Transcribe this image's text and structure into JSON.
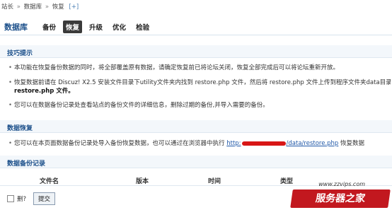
{
  "breadcrumb": {
    "items": [
      "站长",
      "数据库",
      "恢复"
    ],
    "separator": "»",
    "plus": "[+]"
  },
  "header": {
    "title": "数据库",
    "tabs": [
      "备份",
      "恢复",
      "升级",
      "优化",
      "检验"
    ],
    "active_tab": "恢复"
  },
  "tips": {
    "heading": "技巧提示",
    "items": [
      "本功能在恢复备份数据的同时，将全部覆盖原有数据，请确定恢复前已将论坛关闭，恢复全部完成后可以将论坛重新开放。",
      "恢复数据前请在 Discuz! X2.5 安装文件目录下utility文件夹内找到 restore.php 文件，然后将 restore.php 文件上传到程序文件夹data目录下。为了您站点的安全，成功恢复数据后请务必及时删除",
      "restore.php 文件。",
      "您可以在数据备份记录处查看站点的备份文件的详细信息，删除过期的备份,并导入需要的备份。"
    ]
  },
  "restore": {
    "heading": "数据恢复",
    "text": "您可以在本页面数据备份记录处导入备份恢复数据，也可以通过在浏览器中执行",
    "link_suffix": "/data/restore.php",
    "tail": "恢复数据"
  },
  "records": {
    "heading": "数据备份记录",
    "columns": [
      "文件名",
      "版本",
      "时间",
      "类型"
    ]
  },
  "footer": {
    "checkbox_label": "删?",
    "submit_label": "提交"
  },
  "watermark": {
    "url": "www.zzvips.com",
    "brand": "服务器之家"
  },
  "colors": {
    "accent": "#1b4f8a",
    "link": "#2058a8",
    "redaction": "#d81616",
    "brand_red": "#c2181f"
  }
}
